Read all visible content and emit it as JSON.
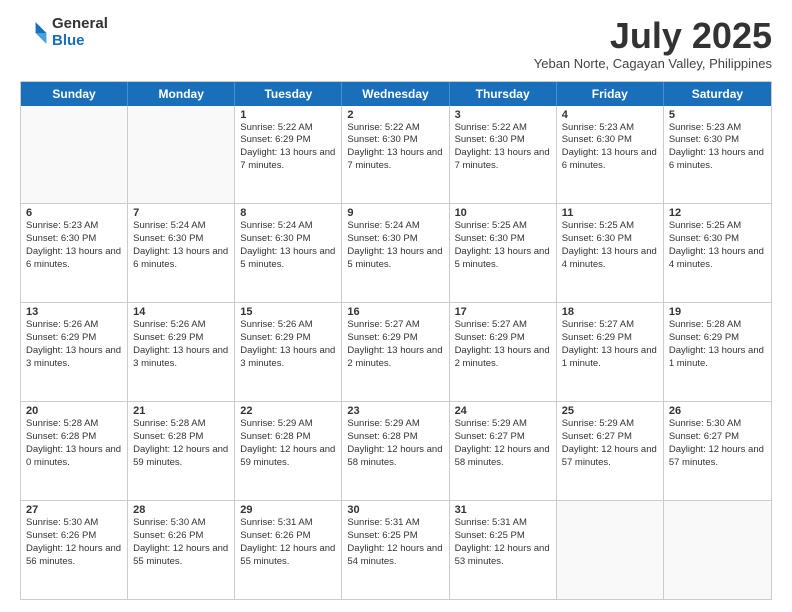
{
  "logo": {
    "general": "General",
    "blue": "Blue"
  },
  "title": "July 2025",
  "subtitle": "Yeban Norte, Cagayan Valley, Philippines",
  "header_days": [
    "Sunday",
    "Monday",
    "Tuesday",
    "Wednesday",
    "Thursday",
    "Friday",
    "Saturday"
  ],
  "weeks": [
    [
      {
        "day": "",
        "sunrise": "",
        "sunset": "",
        "daylight": ""
      },
      {
        "day": "",
        "sunrise": "",
        "sunset": "",
        "daylight": ""
      },
      {
        "day": "1",
        "sunrise": "Sunrise: 5:22 AM",
        "sunset": "Sunset: 6:29 PM",
        "daylight": "Daylight: 13 hours and 7 minutes."
      },
      {
        "day": "2",
        "sunrise": "Sunrise: 5:22 AM",
        "sunset": "Sunset: 6:30 PM",
        "daylight": "Daylight: 13 hours and 7 minutes."
      },
      {
        "day": "3",
        "sunrise": "Sunrise: 5:22 AM",
        "sunset": "Sunset: 6:30 PM",
        "daylight": "Daylight: 13 hours and 7 minutes."
      },
      {
        "day": "4",
        "sunrise": "Sunrise: 5:23 AM",
        "sunset": "Sunset: 6:30 PM",
        "daylight": "Daylight: 13 hours and 6 minutes."
      },
      {
        "day": "5",
        "sunrise": "Sunrise: 5:23 AM",
        "sunset": "Sunset: 6:30 PM",
        "daylight": "Daylight: 13 hours and 6 minutes."
      }
    ],
    [
      {
        "day": "6",
        "sunrise": "Sunrise: 5:23 AM",
        "sunset": "Sunset: 6:30 PM",
        "daylight": "Daylight: 13 hours and 6 minutes."
      },
      {
        "day": "7",
        "sunrise": "Sunrise: 5:24 AM",
        "sunset": "Sunset: 6:30 PM",
        "daylight": "Daylight: 13 hours and 6 minutes."
      },
      {
        "day": "8",
        "sunrise": "Sunrise: 5:24 AM",
        "sunset": "Sunset: 6:30 PM",
        "daylight": "Daylight: 13 hours and 5 minutes."
      },
      {
        "day": "9",
        "sunrise": "Sunrise: 5:24 AM",
        "sunset": "Sunset: 6:30 PM",
        "daylight": "Daylight: 13 hours and 5 minutes."
      },
      {
        "day": "10",
        "sunrise": "Sunrise: 5:25 AM",
        "sunset": "Sunset: 6:30 PM",
        "daylight": "Daylight: 13 hours and 5 minutes."
      },
      {
        "day": "11",
        "sunrise": "Sunrise: 5:25 AM",
        "sunset": "Sunset: 6:30 PM",
        "daylight": "Daylight: 13 hours and 4 minutes."
      },
      {
        "day": "12",
        "sunrise": "Sunrise: 5:25 AM",
        "sunset": "Sunset: 6:30 PM",
        "daylight": "Daylight: 13 hours and 4 minutes."
      }
    ],
    [
      {
        "day": "13",
        "sunrise": "Sunrise: 5:26 AM",
        "sunset": "Sunset: 6:29 PM",
        "daylight": "Daylight: 13 hours and 3 minutes."
      },
      {
        "day": "14",
        "sunrise": "Sunrise: 5:26 AM",
        "sunset": "Sunset: 6:29 PM",
        "daylight": "Daylight: 13 hours and 3 minutes."
      },
      {
        "day": "15",
        "sunrise": "Sunrise: 5:26 AM",
        "sunset": "Sunset: 6:29 PM",
        "daylight": "Daylight: 13 hours and 3 minutes."
      },
      {
        "day": "16",
        "sunrise": "Sunrise: 5:27 AM",
        "sunset": "Sunset: 6:29 PM",
        "daylight": "Daylight: 13 hours and 2 minutes."
      },
      {
        "day": "17",
        "sunrise": "Sunrise: 5:27 AM",
        "sunset": "Sunset: 6:29 PM",
        "daylight": "Daylight: 13 hours and 2 minutes."
      },
      {
        "day": "18",
        "sunrise": "Sunrise: 5:27 AM",
        "sunset": "Sunset: 6:29 PM",
        "daylight": "Daylight: 13 hours and 1 minute."
      },
      {
        "day": "19",
        "sunrise": "Sunrise: 5:28 AM",
        "sunset": "Sunset: 6:29 PM",
        "daylight": "Daylight: 13 hours and 1 minute."
      }
    ],
    [
      {
        "day": "20",
        "sunrise": "Sunrise: 5:28 AM",
        "sunset": "Sunset: 6:28 PM",
        "daylight": "Daylight: 13 hours and 0 minutes."
      },
      {
        "day": "21",
        "sunrise": "Sunrise: 5:28 AM",
        "sunset": "Sunset: 6:28 PM",
        "daylight": "Daylight: 12 hours and 59 minutes."
      },
      {
        "day": "22",
        "sunrise": "Sunrise: 5:29 AM",
        "sunset": "Sunset: 6:28 PM",
        "daylight": "Daylight: 12 hours and 59 minutes."
      },
      {
        "day": "23",
        "sunrise": "Sunrise: 5:29 AM",
        "sunset": "Sunset: 6:28 PM",
        "daylight": "Daylight: 12 hours and 58 minutes."
      },
      {
        "day": "24",
        "sunrise": "Sunrise: 5:29 AM",
        "sunset": "Sunset: 6:27 PM",
        "daylight": "Daylight: 12 hours and 58 minutes."
      },
      {
        "day": "25",
        "sunrise": "Sunrise: 5:29 AM",
        "sunset": "Sunset: 6:27 PM",
        "daylight": "Daylight: 12 hours and 57 minutes."
      },
      {
        "day": "26",
        "sunrise": "Sunrise: 5:30 AM",
        "sunset": "Sunset: 6:27 PM",
        "daylight": "Daylight: 12 hours and 57 minutes."
      }
    ],
    [
      {
        "day": "27",
        "sunrise": "Sunrise: 5:30 AM",
        "sunset": "Sunset: 6:26 PM",
        "daylight": "Daylight: 12 hours and 56 minutes."
      },
      {
        "day": "28",
        "sunrise": "Sunrise: 5:30 AM",
        "sunset": "Sunset: 6:26 PM",
        "daylight": "Daylight: 12 hours and 55 minutes."
      },
      {
        "day": "29",
        "sunrise": "Sunrise: 5:31 AM",
        "sunset": "Sunset: 6:26 PM",
        "daylight": "Daylight: 12 hours and 55 minutes."
      },
      {
        "day": "30",
        "sunrise": "Sunrise: 5:31 AM",
        "sunset": "Sunset: 6:25 PM",
        "daylight": "Daylight: 12 hours and 54 minutes."
      },
      {
        "day": "31",
        "sunrise": "Sunrise: 5:31 AM",
        "sunset": "Sunset: 6:25 PM",
        "daylight": "Daylight: 12 hours and 53 minutes."
      },
      {
        "day": "",
        "sunrise": "",
        "sunset": "",
        "daylight": ""
      },
      {
        "day": "",
        "sunrise": "",
        "sunset": "",
        "daylight": ""
      }
    ]
  ]
}
